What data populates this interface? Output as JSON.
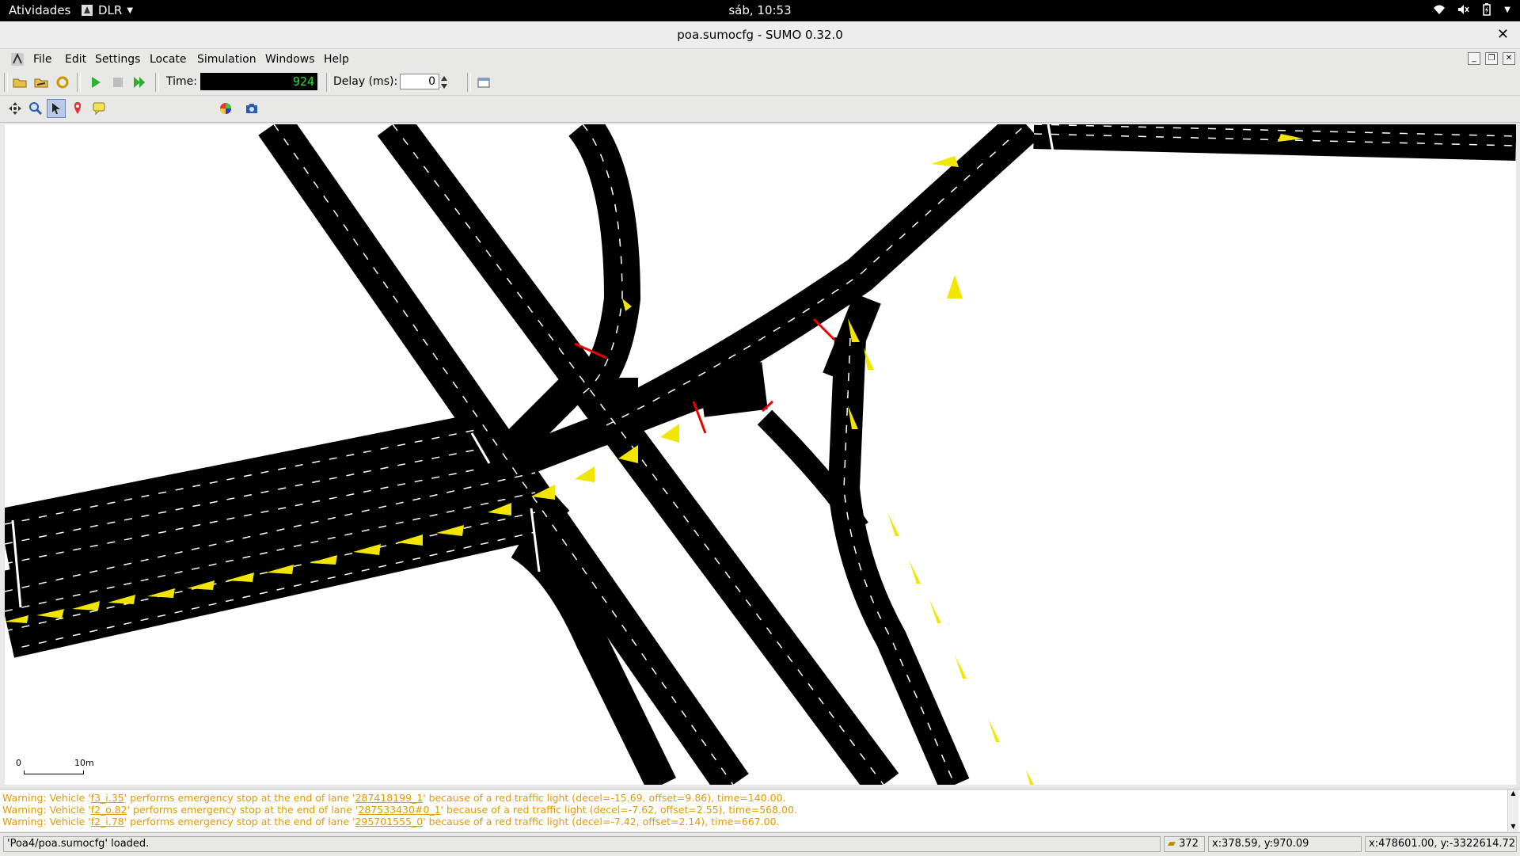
{
  "topbar": {
    "activities": "Atividades",
    "app_name": "DLR",
    "clock": "sáb, 10:53"
  },
  "window": {
    "title": "poa.sumocfg - SUMO 0.32.0"
  },
  "menu": [
    "File",
    "Edit",
    "Settings",
    "Locate",
    "Simulation",
    "Windows",
    "Help"
  ],
  "toolbar": {
    "time_label": "Time:",
    "time_value": "924",
    "delay_label": "Delay (ms):",
    "delay_value": "0"
  },
  "view": {
    "scheme": "standard"
  },
  "scale": {
    "zero": "0",
    "distance": "10m"
  },
  "log": [
    {
      "prefix": "Warning: Vehicle '",
      "vehicle": "f3_i.35",
      "mid": "' performs emergency stop at the end of lane '",
      "lane": "287418199_1",
      "suffix": "' because of a red traffic light (decel=-15.69, offset=9.86), time=140.00."
    },
    {
      "prefix": "Warning: Vehicle '",
      "vehicle": "f2_o.82",
      "mid": "' performs emergency stop at the end of lane '",
      "lane": "287533430#0_1",
      "suffix": "' because of a red traffic light (decel=-7.62, offset=2.55), time=568.00."
    },
    {
      "prefix": "Warning: Vehicle '",
      "vehicle": "f2_i.78",
      "mid": "' performs emergency stop at the end of lane '",
      "lane": "295701555_0",
      "suffix": "' because of a red traffic light (decel=-7.42, offset=2.14), time=667.00."
    }
  ],
  "status": {
    "message": "'Poa4/poa.sumocfg' loaded.",
    "vehicle_count": "372",
    "cursor_coords": "x:378.59, y:970.09",
    "geo_coords": "x:478601.00, y:-3322614.72"
  }
}
